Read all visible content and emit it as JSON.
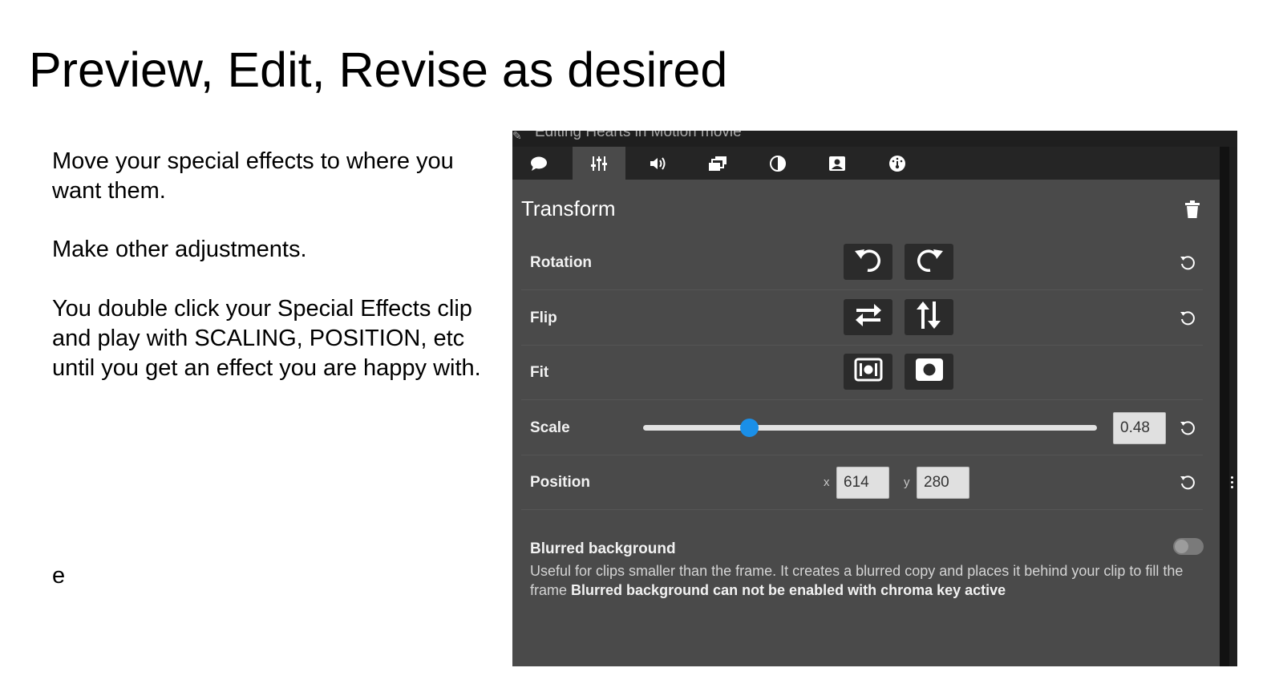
{
  "slide": {
    "title": "Preview, Edit, Revise as desired",
    "notes": [
      "Move your special effects to where you want them.",
      "Make other adjustments.",
      "You double click  your Special Effects clip and play with SCALING, POSITION, etc  until you get an effect you are  happy with."
    ],
    "stray_letter": "e"
  },
  "editor": {
    "window_title": "Editing Hearts in Motion movie",
    "tabs": [
      {
        "icon": "speech-bubble-icon",
        "active": false
      },
      {
        "icon": "sliders-icon",
        "active": true
      },
      {
        "icon": "speaker-icon",
        "active": false
      },
      {
        "icon": "layers-icon",
        "active": false
      },
      {
        "icon": "contrast-icon",
        "active": false
      },
      {
        "icon": "portrait-icon",
        "active": false
      },
      {
        "icon": "speedometer-icon",
        "active": false
      }
    ],
    "panel_title": "Transform",
    "rows": {
      "rotation": {
        "label": "Rotation"
      },
      "flip": {
        "label": "Flip"
      },
      "fit": {
        "label": "Fit"
      },
      "scale": {
        "label": "Scale",
        "value": "0.48",
        "slider_fraction": 0.233
      },
      "position": {
        "label": "Position",
        "x_label": "x",
        "x_value": "614",
        "y_label": "y",
        "y_value": "280"
      }
    },
    "blurred_background": {
      "title": "Blurred background",
      "description": "Useful for clips smaller than the frame. It creates a blurred copy and places it behind your clip to fill the frame",
      "warning": "Blurred background can not be enabled with chroma key active",
      "enabled": false
    },
    "colors": {
      "accent": "#1a8fe8",
      "panel_bg": "#4a4a4a",
      "tabbar_bg": "#252525"
    }
  }
}
